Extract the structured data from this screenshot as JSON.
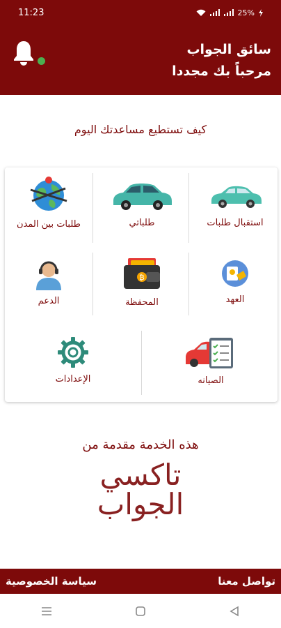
{
  "status_bar": {
    "time": "11:23",
    "battery": "25%"
  },
  "header": {
    "title": "سائق الجواب",
    "subtitle": "مرحباً بك مجددا"
  },
  "question": "كيف تستطيع مساعدتك اليوم",
  "tiles": [
    {
      "label": "استقبال طلبات",
      "icon": "car-icon"
    },
    {
      "label": "طلباتي",
      "icon": "taxi-icon"
    },
    {
      "label": "طلبات بين المدن",
      "icon": "globe-icon"
    },
    {
      "label": "العهد",
      "icon": "custody-icon"
    },
    {
      "label": "المحفظة",
      "icon": "wallet-icon"
    },
    {
      "label": "الدعم",
      "icon": "support-icon"
    },
    {
      "label": "الصيانه",
      "icon": "maintenance-icon"
    },
    {
      "label": "الإعدادات",
      "icon": "gear-icon"
    }
  ],
  "provided_by": "هذه الخدمة مقدمة من",
  "brand": {
    "line1": "تاكسي",
    "line2": "الجواب"
  },
  "footer": {
    "contact": "تواصل معنا",
    "privacy": "سياسة الخصوصية"
  },
  "colors": {
    "primary": "#7d0a0a",
    "online": "#4caf50"
  }
}
